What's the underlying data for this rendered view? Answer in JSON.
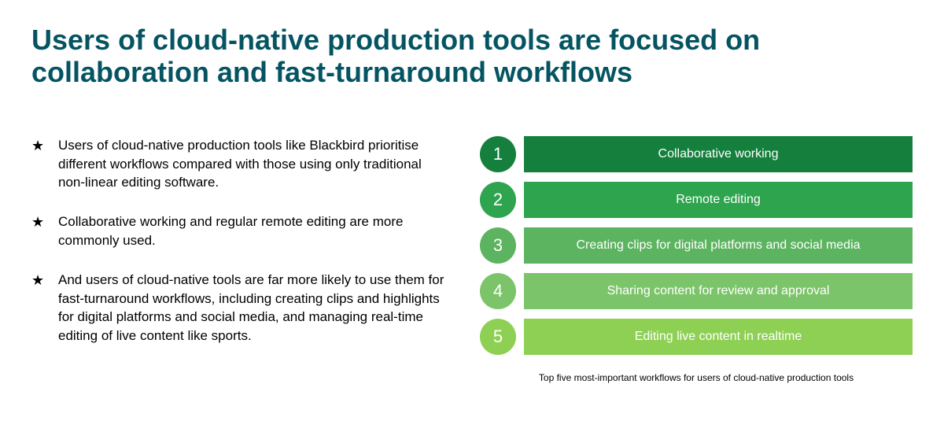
{
  "title": "Users of cloud-native production tools are focused on collaboration and fast-turnaround workflows",
  "bullets": [
    "Users of cloud-native production tools like Blackbird prioritise different workflows compared with those using only traditional non-linear editing software.",
    "Collaborative working and regular remote editing are more commonly used.",
    "And users of cloud-native tools are far more likely to use them for fast-turnaround workflows, including creating clips and highlights for digital platforms and social media, and managing real-time editing of live content like sports."
  ],
  "ranked": [
    {
      "n": "1",
      "label": "Collaborative working",
      "color": "#15803d"
    },
    {
      "n": "2",
      "label": "Remote editing",
      "color": "#2fa44f"
    },
    {
      "n": "3",
      "label": "Creating clips for digital platforms and social media",
      "color": "#5cb460"
    },
    {
      "n": "4",
      "label": "Sharing content for review and approval",
      "color": "#7cc46a"
    },
    {
      "n": "5",
      "label": "Editing live content in realtime",
      "color": "#8ed054"
    }
  ],
  "caption": "Top five most-important workflows for users of cloud-native production tools"
}
